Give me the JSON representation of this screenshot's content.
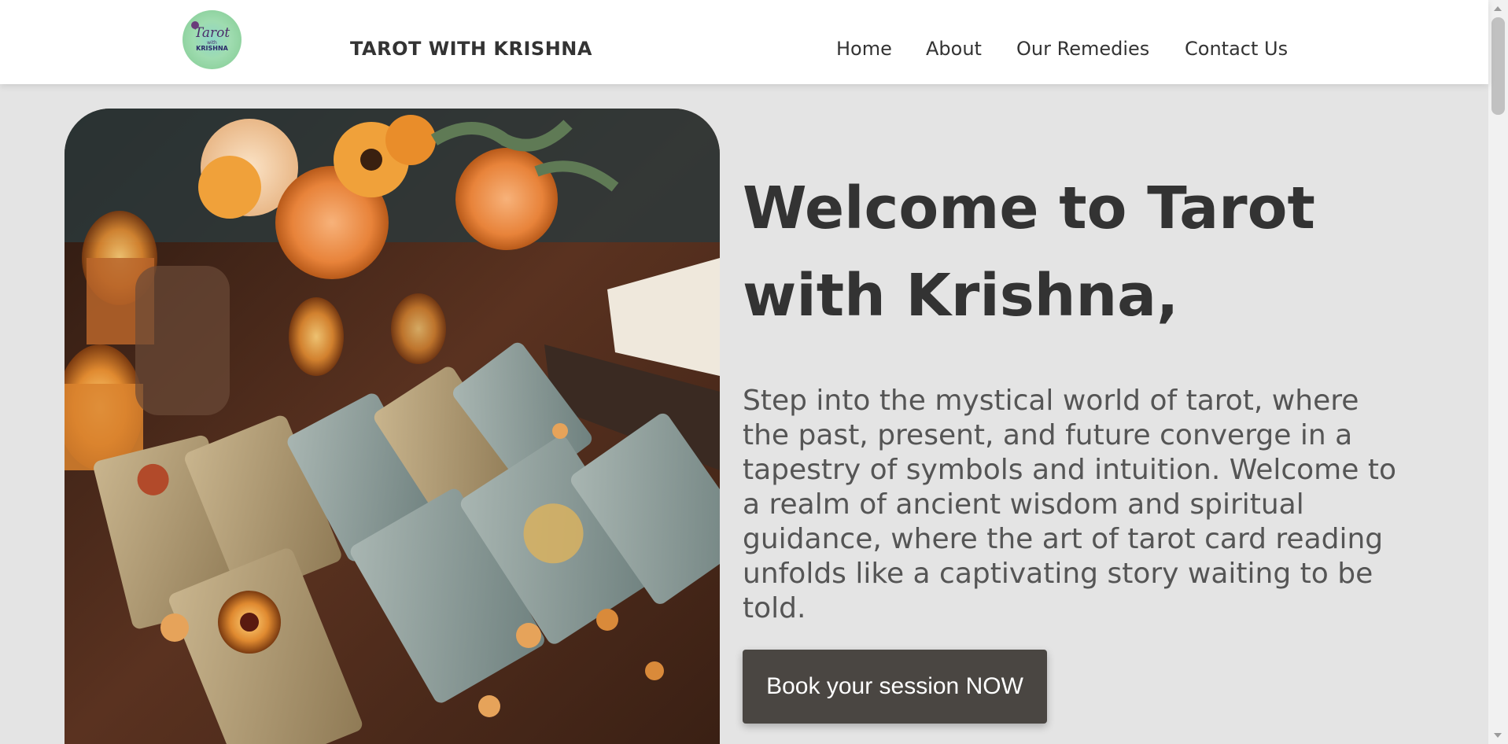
{
  "header": {
    "logo": {
      "line1": "Tarot",
      "line2": "with",
      "line3": "KRISHNA"
    },
    "brand": "TAROT WITH KRISHNA",
    "nav": [
      {
        "label": "Home"
      },
      {
        "label": "About"
      },
      {
        "label": "Our Remedies"
      },
      {
        "label": "Contact Us"
      }
    ]
  },
  "hero": {
    "image_icon": "tarot-cards-image",
    "headline": "Welcome to Tarot with Krishna,",
    "intro": "Step into the mystical world of tarot, where the past, present, and future converge in a tapestry of symbols and intuition. Welcome to a realm of ancient wisdom and spiritual guidance, where the art of tarot card reading unfolds like a captivating story waiting to be told.",
    "cta_label": "Book your session NOW"
  },
  "colors": {
    "background": "#e4e4e4",
    "header_bg": "#ffffff",
    "text_dark": "#333333",
    "text_body": "#555555",
    "button_bg": "#4a4642",
    "button_text": "#ffffff"
  }
}
